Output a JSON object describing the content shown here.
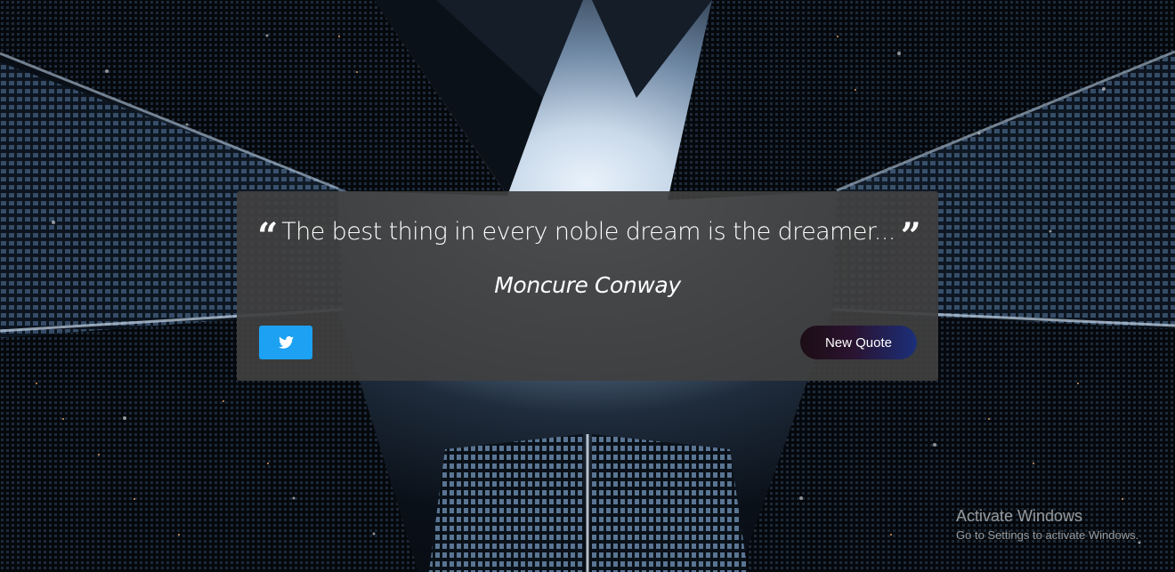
{
  "quote": {
    "open_mark": "“",
    "text": "The best thing in every noble dream is the dreamer...",
    "close_mark": "”",
    "author": "Moncure Conway"
  },
  "buttons": {
    "tweet_icon": "twitter-icon",
    "new_quote_label": "New Quote"
  },
  "watermark": {
    "title": "Activate Windows",
    "subtitle": "Go to Settings to activate Windows."
  },
  "colors": {
    "card_background": "#404040",
    "tweet_button": "#1da1f2",
    "new_quote_gradient_start": "#1c0d14",
    "new_quote_gradient_end": "#1b2f7a",
    "text": "#ffffff"
  }
}
